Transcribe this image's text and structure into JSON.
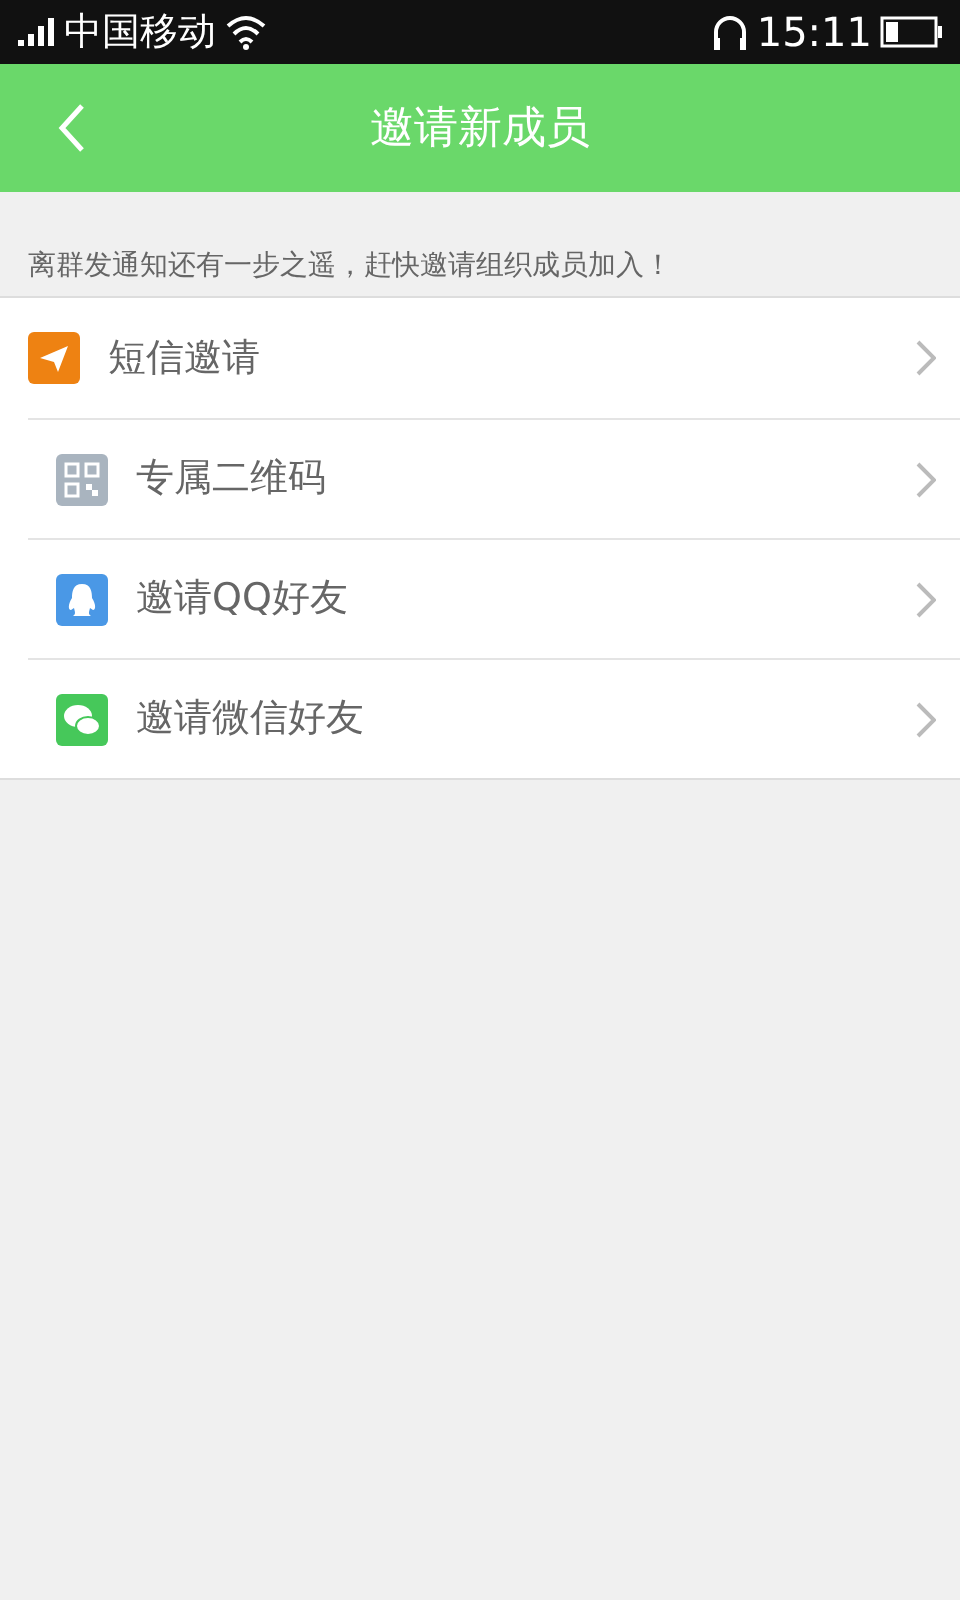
{
  "status_bar": {
    "carrier": "中国移动",
    "time": "15:11"
  },
  "header": {
    "title": "邀请新成员"
  },
  "hint": "离群发通知还有一步之遥，赶快邀请组织成员加入！",
  "items": [
    {
      "kind": "sms",
      "label": "短信邀请"
    },
    {
      "kind": "qrcode",
      "label": "专属二维码"
    },
    {
      "kind": "qq",
      "label": "邀请QQ好友"
    },
    {
      "kind": "wechat",
      "label": "邀请微信好友"
    }
  ]
}
